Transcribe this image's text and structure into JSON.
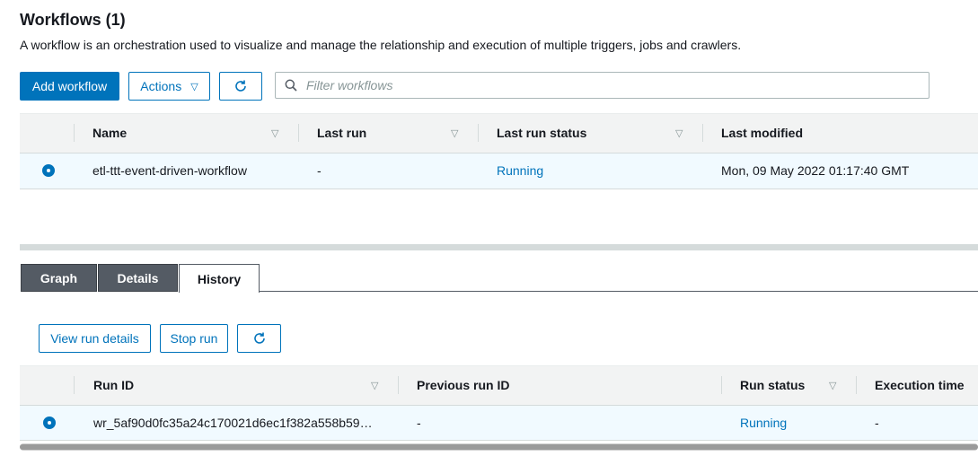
{
  "header": {
    "title": "Workflows (1)",
    "description": "A workflow is an orchestration used to visualize and manage the relationship and execution of multiple triggers, jobs and crawlers."
  },
  "toolbar": {
    "add_label": "Add workflow",
    "actions_label": "Actions",
    "filter_placeholder": "Filter workflows"
  },
  "workflows_table": {
    "columns": [
      "Name",
      "Last run",
      "Last run status",
      "Last modified"
    ],
    "rows": [
      {
        "name": "etl-ttt-event-driven-workflow",
        "last_run": "-",
        "last_run_status": "Running",
        "last_modified": "Mon, 09 May 2022 01:17:40 GMT"
      }
    ]
  },
  "tabs": [
    "Graph",
    "Details",
    "History"
  ],
  "active_tab": "History",
  "history": {
    "view_label": "View run details",
    "stop_label": "Stop run",
    "columns": [
      "Run ID",
      "Previous run ID",
      "Run status",
      "Execution time"
    ],
    "rows": [
      {
        "run_id": "wr_5af90d0fc35a24c170021d6ec1f382a558b59…",
        "previous_run_id": "-",
        "run_status": "Running",
        "execution_time": "-"
      }
    ]
  },
  "colors": {
    "accent": "#0073bb",
    "selected_row": "#f1faff",
    "header_bg": "#f2f3f3",
    "tab_dark": "#545b64"
  }
}
